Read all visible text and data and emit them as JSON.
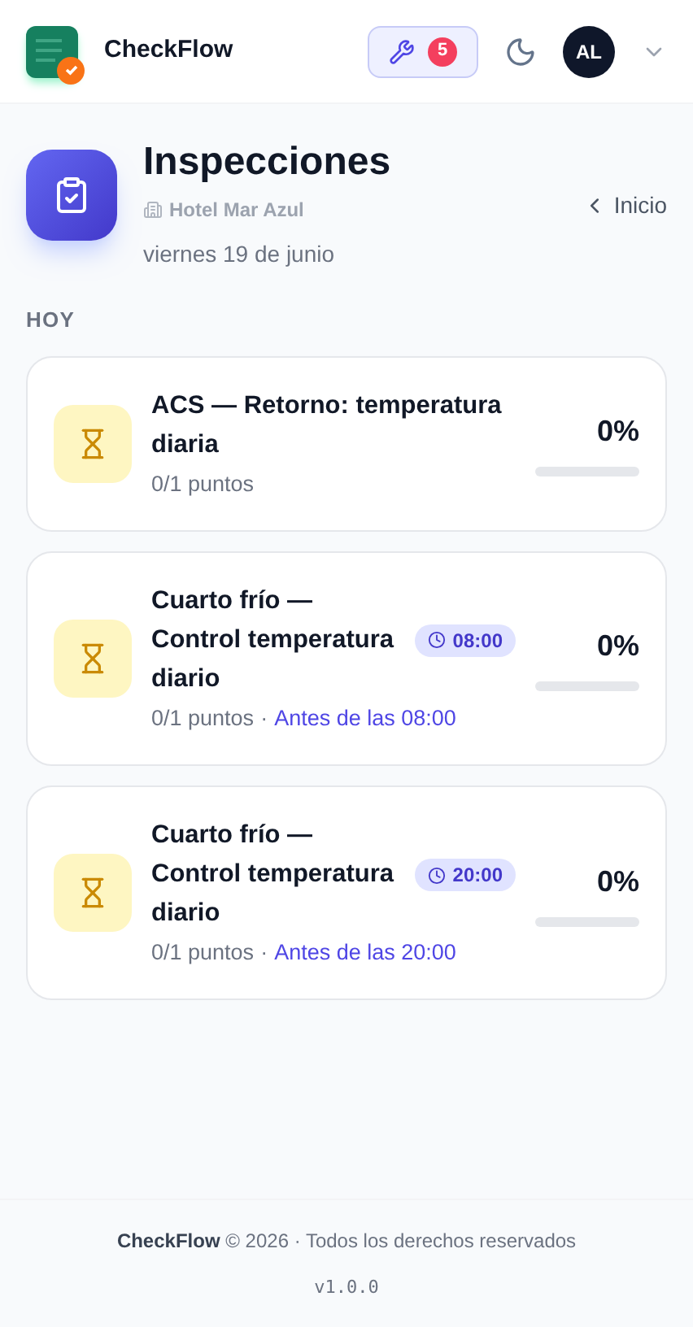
{
  "header": {
    "brand": "CheckFlow",
    "tools_badge": "5",
    "avatar": "AL"
  },
  "page": {
    "title": "Inspecciones",
    "location": "Hotel Mar Azul",
    "date": "viernes 19 de junio",
    "back_link": "Inicio"
  },
  "section": "HOY",
  "inspections": [
    {
      "title": "ACS — Retorno: temperatura diaria",
      "points": "0/1 puntos",
      "percent": "0%",
      "level": 0
    },
    {
      "title": "Cuarto frío — Control temperatura diario",
      "time_badge": "08:00",
      "points": "0/1 puntos",
      "separator": "·",
      "deadline": "Antes de las 08:00",
      "percent": "0%",
      "level": 0
    },
    {
      "title": "Cuarto frío — Control temperatura diario",
      "time_badge": "20:00",
      "points": "0/1 puntos",
      "separator": "·",
      "deadline": "Antes de las 20:00",
      "percent": "0%",
      "level": 0
    }
  ],
  "footer": {
    "text": "**CheckFlow** © 2026 · Todos los derechos reservados",
    "version": "v1.0.0"
  }
}
